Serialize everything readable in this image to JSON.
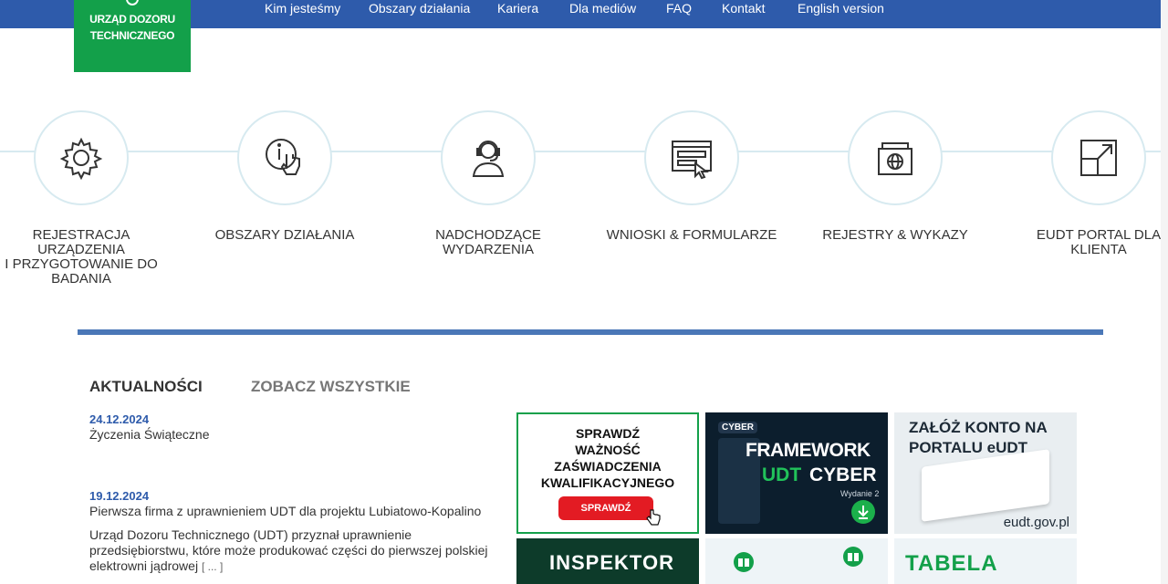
{
  "logo": {
    "line1": "URZĄD DOZORU",
    "line2": "TECHNICZNEGO"
  },
  "nav": [
    {
      "label": "Kim jesteśmy"
    },
    {
      "label": "Obszary działania"
    },
    {
      "label": "Kariera"
    },
    {
      "label": "Dla mediów"
    },
    {
      "label": "FAQ"
    },
    {
      "label": "Kontakt"
    },
    {
      "label": "English version"
    }
  ],
  "tiles": [
    {
      "label": "REJESTRACJA\nURZĄDZENIA\nI PRZYGOTOWANIE DO\nBADANIA",
      "icon": "gear-icon"
    },
    {
      "label": "OBSZARY DZIAŁANIA",
      "icon": "info-touch-icon"
    },
    {
      "label": "NADCHODZĄCE\nWYDARZENIA",
      "icon": "headset-person-icon"
    },
    {
      "label": "WNIOSKI & FORMULARZE",
      "icon": "browser-form-icon"
    },
    {
      "label": "REJESTRY & WYKAZY",
      "icon": "registry-icon"
    },
    {
      "label": "EUDT PORTAL DLA\nKLIENTA",
      "icon": "external-link-icon"
    }
  ],
  "news": {
    "heading": "AKTUALNOŚCI",
    "see_all": "ZOBACZ WSZYSTKIE",
    "items": [
      {
        "date": "24.12.2024",
        "title": "Życzenia Świąteczne"
      },
      {
        "date": "19.12.2024",
        "title": "Pierwsza firma z uprawnieniem UDT dla projektu Lubiatowo-Kopalino",
        "excerpt": "Urząd Dozoru Technicznego (UDT) przyznał uprawnienie przedsiębiorstwu, które może produkować części do pierwszej polskiej elektrowni jądrowej",
        "more": "[ ... ]"
      }
    ]
  },
  "promos": {
    "check": {
      "text": "SPRAWDŹ\nWAŻNOŚĆ\nZAŚWIADCZENIA\nKWALIFIKACYJNEGO",
      "button": "SPRAWDŹ"
    },
    "cyber": {
      "badge": "CYBER",
      "title1": "FRAMEWORK",
      "title2a": "UDT",
      "title2b": "CYBER",
      "edition": "Wydanie 2"
    },
    "account": {
      "text": "ZAŁÓŻ KONTO NA\nPORTALU eUDT",
      "url": "eudt.gov.pl"
    },
    "inspector": {
      "text": "INSPEKTOR"
    },
    "table": {
      "text": "TABELA"
    }
  },
  "colors": {
    "brand_blue": "#2e5bab",
    "brand_green": "#13a04a",
    "accent_red": "#e31b23"
  }
}
